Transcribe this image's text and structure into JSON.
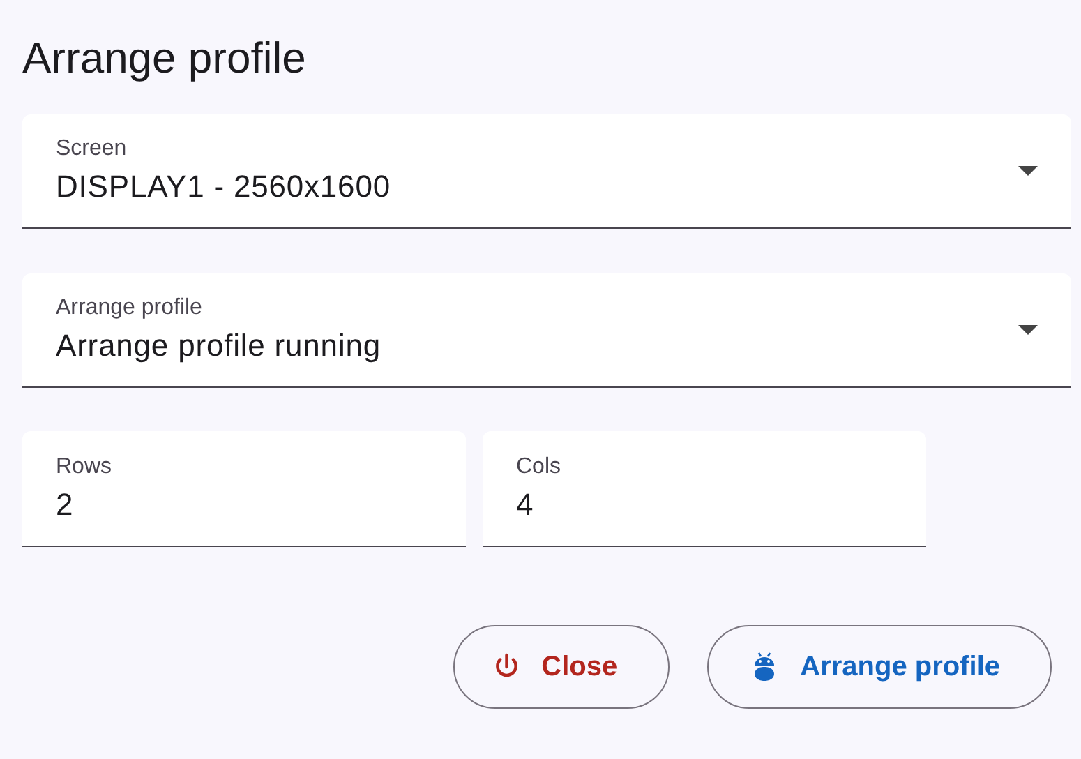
{
  "title": "Arrange profile",
  "selects": [
    {
      "label": "Screen",
      "value": "DISPLAY1 - 2560x1600"
    },
    {
      "label": "Arrange profile",
      "value": "Arrange profile running"
    }
  ],
  "inputs": [
    {
      "label": "Rows",
      "value": "2"
    },
    {
      "label": "Cols",
      "value": "4"
    }
  ],
  "buttons": [
    {
      "kind": "close",
      "label": "Close"
    },
    {
      "kind": "arrange",
      "label": "Arrange profile"
    }
  ]
}
